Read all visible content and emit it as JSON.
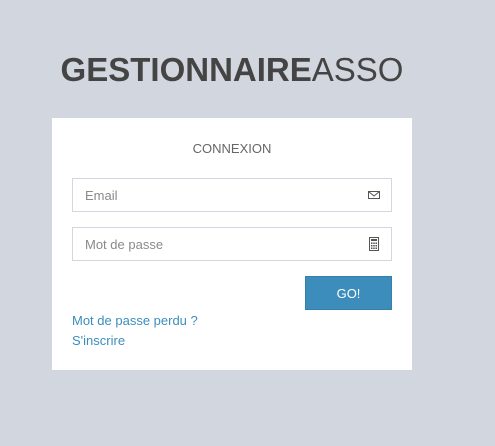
{
  "logo": {
    "bold": "GESTIONNAIRE",
    "light": "ASSO"
  },
  "login": {
    "title": "CONNEXION",
    "email": {
      "placeholder": "Email",
      "value": "",
      "icon": "envelope-icon"
    },
    "password": {
      "placeholder": "Mot de passe",
      "value": "",
      "icon": "keypad-icon"
    },
    "submit_label": "GO!",
    "lost_password_link": "Mot de passe perdu ?",
    "register_link": "S'inscrire"
  },
  "colors": {
    "background": "#d2d6de",
    "accent": "#3c8dbc",
    "box": "#ffffff",
    "text": "#444444"
  }
}
